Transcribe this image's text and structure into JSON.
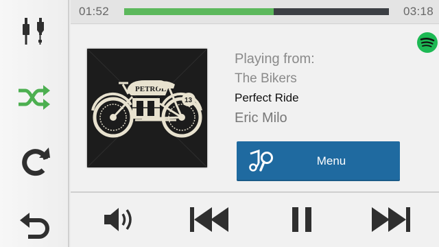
{
  "sidebar": {
    "items": [
      {
        "name": "audio-source-icon",
        "label": "Audio source"
      },
      {
        "name": "shuffle-icon",
        "label": "Shuffle"
      },
      {
        "name": "repeat-icon",
        "label": "Repeat"
      },
      {
        "name": "back-icon",
        "label": "Back"
      }
    ]
  },
  "progress": {
    "elapsed": "01:52",
    "total": "03:18",
    "fraction": 0.566
  },
  "now_playing": {
    "playing_from_label": "Playing from:",
    "playlist": "The Bikers",
    "track_title": "Perfect Ride",
    "artist": "Eric Milo"
  },
  "menu_button": {
    "label": "Menu",
    "icon": "music-search-icon"
  },
  "controls": {
    "items": [
      "volume-icon",
      "previous-icon",
      "pause-icon",
      "next-icon"
    ]
  },
  "colors": {
    "accent_green": "#5cb85c",
    "menu_blue": "#1f6aa0",
    "spotify_green": "#1db954",
    "icon_dark": "#2f2f2f"
  }
}
